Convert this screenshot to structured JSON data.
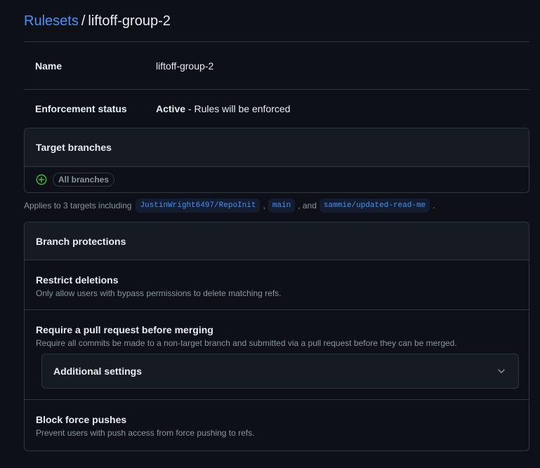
{
  "breadcrumb": {
    "parent": "Rulesets",
    "separator": "/",
    "current": "liftoff-group-2"
  },
  "details": {
    "name_label": "Name",
    "name_value": "liftoff-group-2",
    "enforcement_label": "Enforcement status",
    "enforcement_status": "Active",
    "enforcement_suffix": " - Rules will be enforced"
  },
  "target_branches": {
    "title": "Target branches",
    "pill": "All branches",
    "applies_prefix": "Applies to 3 targets including",
    "targets": [
      "JustinWright6497/RepoInit",
      "main",
      "sammie/updated-read-me"
    ],
    "comma": ",",
    "and_text": ", and",
    "period": "."
  },
  "branch_protections": {
    "title": "Branch protections",
    "rules": [
      {
        "title": "Restrict deletions",
        "description": "Only allow users with bypass permissions to delete matching refs."
      },
      {
        "title": "Require a pull request before merging",
        "description": "Require all commits be made to a non-target branch and submitted via a pull request before they can be merged.",
        "additional_settings": "Additional settings"
      },
      {
        "title": "Block force pushes",
        "description": "Prevent users with push access from force pushing to refs."
      }
    ]
  },
  "icons": {
    "add": "plus-circle-icon",
    "expand": "chevron-down-icon"
  },
  "colors": {
    "background": "#0d1117",
    "link": "#4493f8",
    "border": "#30363d",
    "success": "#3fb950"
  }
}
